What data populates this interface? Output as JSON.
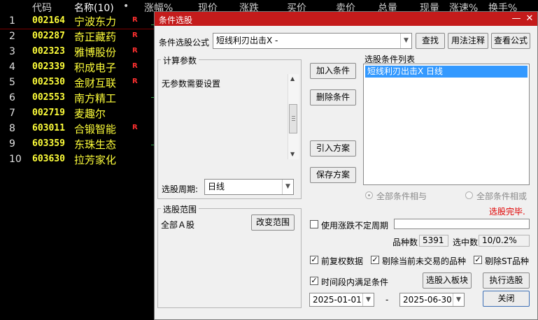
{
  "list": {
    "columns": [
      "代码",
      "名称(10)",
      "•",
      "涨幅%",
      "现价",
      "涨跌",
      "买价",
      "卖价",
      "总量",
      "现量",
      "涨速%",
      "换手%"
    ],
    "rows": [
      {
        "idx": "1",
        "code": "002164",
        "name": "宁波东力",
        "flag": "R"
      },
      {
        "idx": "2",
        "code": "002287",
        "name": "奇正藏药",
        "flag": "R"
      },
      {
        "idx": "3",
        "code": "002323",
        "name": "雅博股份",
        "flag": "R"
      },
      {
        "idx": "4",
        "code": "002339",
        "name": "积成电子",
        "flag": "R"
      },
      {
        "idx": "5",
        "code": "002530",
        "name": "金财互联",
        "flag": "R"
      },
      {
        "idx": "6",
        "code": "002553",
        "name": "南方精工",
        "flag": ""
      },
      {
        "idx": "7",
        "code": "002719",
        "name": "麦趣尔",
        "flag": ""
      },
      {
        "idx": "8",
        "code": "603011",
        "name": "合锻智能",
        "flag": "R"
      },
      {
        "idx": "9",
        "code": "603359",
        "name": "东珠生态",
        "flag": ""
      },
      {
        "idx": "10",
        "code": "603630",
        "name": "拉芳家化",
        "flag": ""
      }
    ]
  },
  "dialog": {
    "title": "条件选股",
    "minimize": "—",
    "close": "✕",
    "formula_label": "条件选股公式",
    "formula_value": "短线利刃出击X -",
    "find_button": "查找",
    "usage_button": "用法注释",
    "view_formula_button": "查看公式",
    "params_group": "计算参数",
    "params_text": "无参数需要设置",
    "period_label": "选股周期:",
    "period_value": "日线",
    "add_condition": "加入条件",
    "delete_condition": "删除条件",
    "import_plan": "引入方案",
    "save_plan": "保存方案",
    "conditions_title": "选股条件列表",
    "conditions": [
      "短线利刃出击X  日线"
    ],
    "radio_all_and": "全部条件相与",
    "radio_all_or": "全部条件相或",
    "status": "选股完毕.",
    "status_color": "#e00000",
    "scope_group": "选股范围",
    "scope_value": "全部Ａ股",
    "change_scope": "改变范围",
    "use_uncertain_period": "使用涨跌不定周期",
    "count_label": "品种数",
    "count_value": "5391",
    "selected_label": "选中数",
    "selected_value": "10/0.2%",
    "pre_adjust": "前复权数据",
    "exclude_untraded": "剔除当前未交易的品种",
    "exclude_st": "剔除ST品种",
    "within_period": "时间段内满足条件",
    "to_board": "选股入板块",
    "execute": "执行选股",
    "date_from": "2025-01-01",
    "date_sep": "-",
    "date_to": "2025-06-30",
    "close_button": "关闭",
    "title_color": "#c41b1b",
    "selection_color": "#3399ff"
  }
}
